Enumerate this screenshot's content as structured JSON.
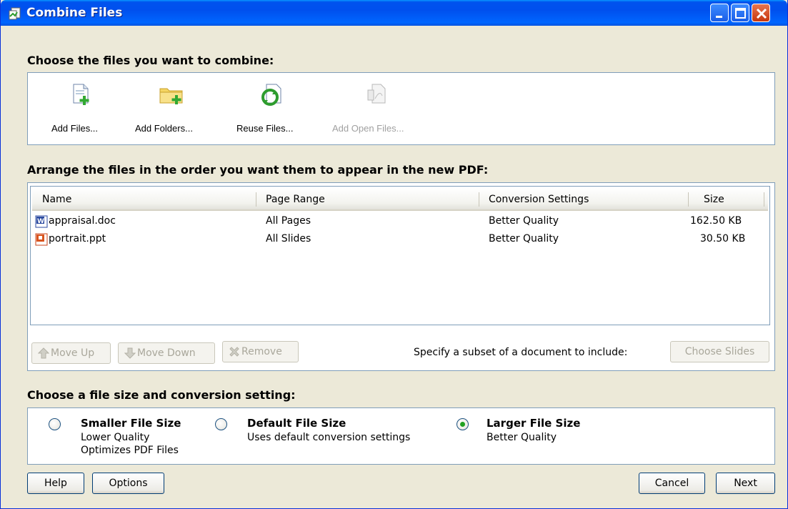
{
  "window": {
    "title": "Combine Files"
  },
  "choose_section": {
    "heading": "Choose the files you want to combine:",
    "tools": [
      {
        "label": "Add Files...",
        "icon": "add-file-icon",
        "enabled": true
      },
      {
        "label": "Add Folders...",
        "icon": "add-folder-icon",
        "enabled": true
      },
      {
        "label": "Reuse Files...",
        "icon": "reuse-files-icon",
        "enabled": true
      },
      {
        "label": "Add Open Files...",
        "icon": "add-open-files-icon",
        "enabled": false
      }
    ]
  },
  "arrange_section": {
    "heading": "Arrange the files in the order you want them to appear in the new PDF:",
    "columns": [
      "Name",
      "Page Range",
      "Conversion Settings",
      "Size"
    ],
    "rows": [
      {
        "name": "appraisal.doc",
        "icon": "word-doc-icon",
        "page_range": "All Pages",
        "conversion": "Better Quality",
        "size": "162.50 KB"
      },
      {
        "name": "portrait.ppt",
        "icon": "powerpoint-icon",
        "page_range": "All Slides",
        "conversion": "Better Quality",
        "size": "30.50 KB"
      }
    ],
    "move_up_label": "Move Up",
    "move_down_label": "Move Down",
    "remove_label": "Remove",
    "subset_hint": "Specify a subset of a document to include:",
    "choose_slides_label": "Choose Slides"
  },
  "size_section": {
    "heading": "Choose a file size and conversion setting:",
    "options": [
      {
        "title": "Smaller File Size",
        "lines": [
          "Lower Quality",
          "Optimizes PDF Files"
        ],
        "selected": false
      },
      {
        "title": "Default File Size",
        "lines": [
          "Uses default conversion settings"
        ],
        "selected": false
      },
      {
        "title": "Larger File Size",
        "lines": [
          "Better Quality"
        ],
        "selected": true
      }
    ]
  },
  "footer": {
    "help_label": "Help",
    "options_label": "Options",
    "cancel_label": "Cancel",
    "next_label": "Next"
  },
  "colors": {
    "titlebar": "#0054e3",
    "dialog_bg": "#ece9d8",
    "panel_border": "#7f9db9",
    "radio_dot": "#21a121"
  }
}
